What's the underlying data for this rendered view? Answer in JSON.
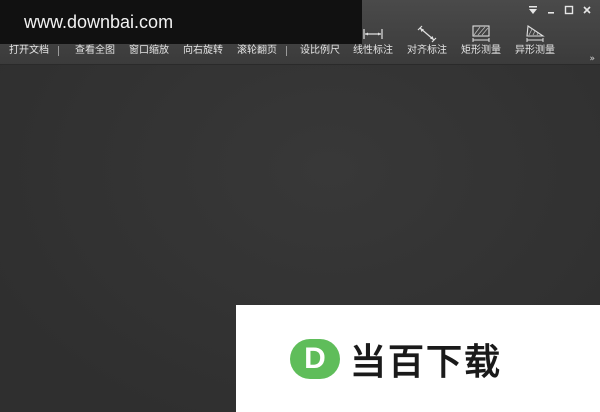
{
  "toolbar": {
    "tools": [
      {
        "id": "open",
        "label": "打开文档",
        "icon": "folder-icon"
      },
      {
        "id": "fit",
        "label": "查看全图",
        "icon": "fit-icon"
      },
      {
        "id": "zoom",
        "label": "窗口缩放",
        "icon": "zoom-window-icon"
      },
      {
        "id": "rotate",
        "label": "向右旋转",
        "icon": "rotate-right-icon"
      },
      {
        "id": "scroll",
        "label": "滚轮翻页",
        "icon": "scroll-wheel-icon"
      },
      {
        "id": "scale",
        "label": "设比例尺",
        "icon": "scale-icon"
      },
      {
        "id": "linear",
        "label": "线性标注",
        "icon": "linear-dimension-icon"
      },
      {
        "id": "aligned",
        "label": "对齐标注",
        "icon": "aligned-dimension-icon"
      },
      {
        "id": "rect",
        "label": "矩形测量",
        "icon": "rect-measure-icon"
      },
      {
        "id": "irregular",
        "label": "异形测量",
        "icon": "irregular-measure-icon"
      }
    ],
    "more": "»"
  },
  "window_controls": {
    "menu": "menu-dropdown-icon",
    "minimize": "minimize-icon",
    "maximize": "maximize-icon",
    "close": "close-icon"
  },
  "watermark": {
    "site": "www.downbai.com",
    "logo_letter": "D",
    "logo_text": "当百下载"
  },
  "colors": {
    "toolbar": "#444444",
    "canvas": "#333333",
    "logo_green": "#5fbd5a"
  }
}
